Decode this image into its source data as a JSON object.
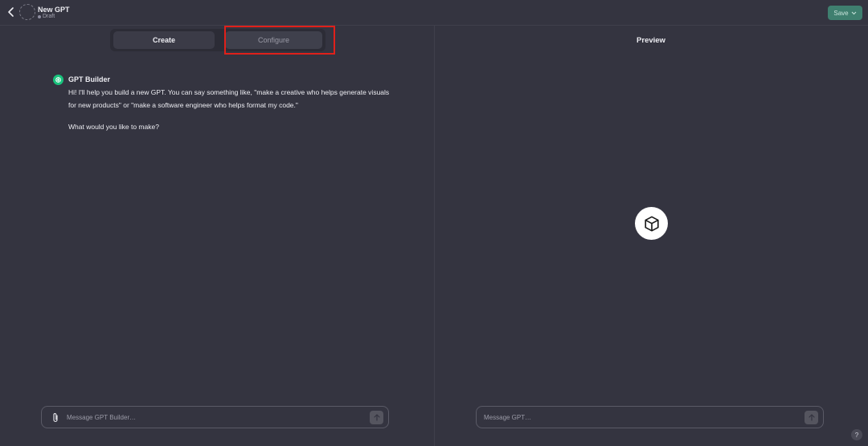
{
  "header": {
    "back_icon": "chevron-left-icon",
    "gpt_name": "New GPT",
    "gpt_status": "Draft",
    "save_label": "Save",
    "save_color": "#3f7f6f"
  },
  "tabs": {
    "create_label": "Create",
    "configure_label": "Configure",
    "highlight_color": "#e0201a"
  },
  "chat": {
    "sender": "GPT Builder",
    "sender_icon": "openai-logo-icon",
    "message_line1": "Hi! I'll help you build a new GPT. You can say something like, \"make a creative who helps generate visuals for new products\" or \"make a software engineer who helps format my code.\"",
    "message_line2": "What would you like to make?",
    "composer_placeholder": "Message GPT Builder…"
  },
  "preview": {
    "title": "Preview",
    "icon": "cube-icon",
    "composer_placeholder": "Message GPT…"
  },
  "help_label": "?"
}
